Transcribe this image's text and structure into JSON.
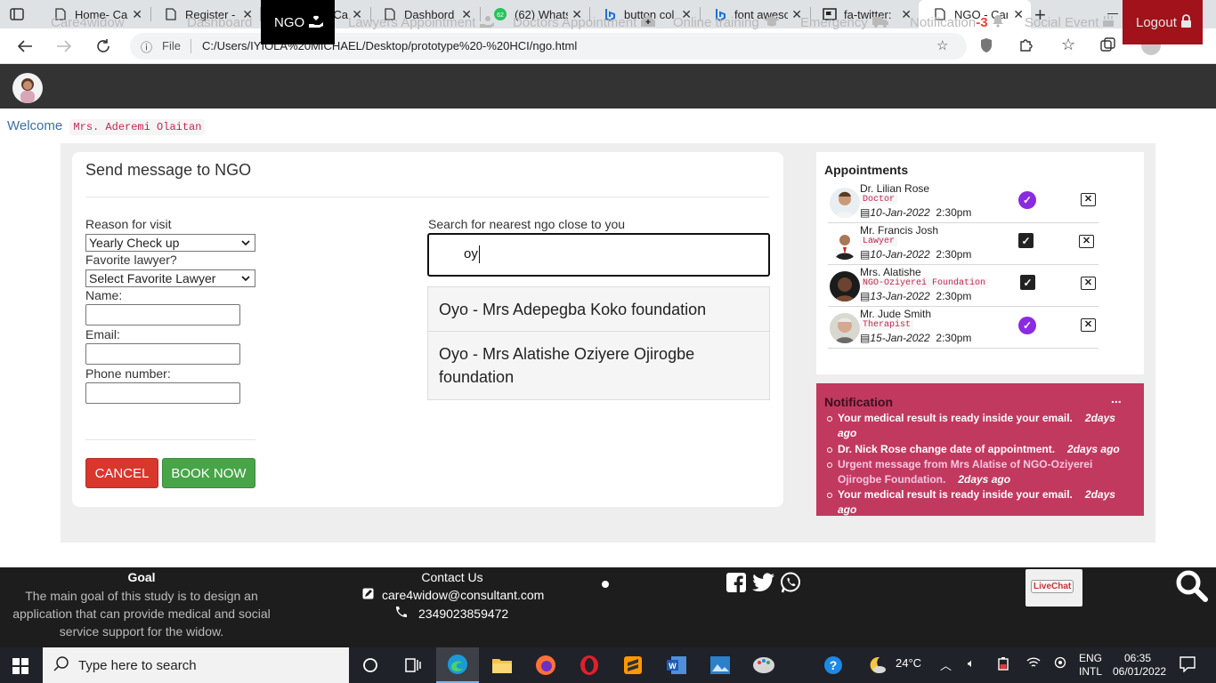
{
  "browser": {
    "tabs": [
      {
        "title": "Home- Car",
        "icon": "page-icon"
      },
      {
        "title": "Register -",
        "icon": "page-icon"
      },
      {
        "title": "Login - Ca",
        "icon": "page-icon"
      },
      {
        "title": "Dashbord",
        "icon": "page-icon"
      },
      {
        "title": "(62) Whats",
        "icon": "whatsapp-icon",
        "badge": "62"
      },
      {
        "title": "button col",
        "icon": "bing-icon"
      },
      {
        "title": "font awesc",
        "icon": "bing-icon"
      },
      {
        "title": "fa-twitter:",
        "icon": "flag-icon"
      },
      {
        "title": "NGO - Car",
        "icon": "page-icon",
        "active": true
      }
    ],
    "address": {
      "scheme_label": "File",
      "url": "C:/Users/IYIOLA%20MICHAEL/Desktop/prototype%20-%20HCI/ngo.html"
    }
  },
  "nav": {
    "brand": "Care4widow",
    "items": [
      {
        "label": "Dashboard",
        "icon": ""
      },
      {
        "label": "NGO",
        "icon": "hand-holding-heart-icon",
        "active": true
      },
      {
        "label": "Lawyers Appointment",
        "icon": "hand-holding-icon"
      },
      {
        "label": "Doctors Appointment",
        "icon": "clinic-house-icon"
      },
      {
        "label": "Online training",
        "icon": "graduation-cap-icon"
      },
      {
        "label": "Emergency",
        "icon": "ambulance-icon"
      },
      {
        "label": "Notification",
        "badge": "-3",
        "icon": "bell-icon"
      },
      {
        "label": "Social Event",
        "icon": "birthday-cake-icon"
      },
      {
        "label": "Logout",
        "icon": "lock-icon"
      }
    ]
  },
  "welcome": {
    "label": "Welcome",
    "name": "Mrs. Aderemi Olaitan"
  },
  "form": {
    "title": "Send message to NGO",
    "reason_label": "Reason for visit",
    "reason_value": "Yearly Check up",
    "lawyer_label": "Favorite lawyer?",
    "lawyer_value": "Select Favorite Lawyer",
    "name_label": "Name:",
    "email_label": "Email:",
    "phone_label": "Phone number:",
    "cancel_label": "CANCEL",
    "book_label": "BOOK NOW"
  },
  "search": {
    "label": "Search for nearest ngo close to you",
    "value": "oy",
    "results": [
      "Oyo - Mrs Adepegba Koko foundation",
      "Oyo - Mrs Alatishe Oziyere Ojirogbe foundation"
    ]
  },
  "appointments": {
    "title": "Appointments",
    "items": [
      {
        "name": "Dr. Lilian Rose",
        "role": "Doctor",
        "date": "10-Jan-2022",
        "time": "2:30pm",
        "status": "verified"
      },
      {
        "name": "Mr. Francis Josh",
        "role": "Lawyer",
        "date": "10-Jan-2022",
        "time": "2:30pm",
        "status": "checked"
      },
      {
        "name": "Mrs. Alatishe",
        "role": "NGO-Oziyerei Foundation",
        "date": "13-Jan-2022",
        "time": "2:30pm",
        "status": "checked"
      },
      {
        "name": "Mr. Jude Smith",
        "role": "Therapist",
        "date": "15-Jan-2022",
        "time": "2:30pm",
        "status": "verified"
      }
    ],
    "colors": {
      "verified": "#8a2be2",
      "checked": "#222222"
    }
  },
  "notifications": {
    "title": "Notification",
    "more": "...",
    "items": [
      {
        "text": "Your medical result is ready inside your email.",
        "ago": "2days ago"
      },
      {
        "text": "Dr. Nick Rose change date of appointment.",
        "ago": "2days ago"
      },
      {
        "text": "Urgent message from Mrs Alatise of NGO-Oziyerei Ojirogbe Foundation.",
        "ago": "2days ago"
      },
      {
        "text": "Your medical result is ready inside your email.",
        "ago": "2days ago"
      }
    ],
    "bg_color": "#c2395f"
  },
  "footer": {
    "goal_title": "Goal",
    "goal_text": "The main goal of this study is to design an application that can provide medical and social service support for the widow.",
    "contact_title": "Contact Us",
    "email": "care4widow@consultant.com",
    "phone": "2349023859472",
    "social_icons": [
      "facebook-icon",
      "twitter-icon",
      "whatsapp-icon"
    ],
    "livechat_label": "LiveChat"
  },
  "taskbar": {
    "search_placeholder": "Type here to search",
    "weather": "24°C",
    "lang_1": "ENG",
    "lang_2": "INTL",
    "time": "06:35",
    "date": "06/01/2022"
  }
}
